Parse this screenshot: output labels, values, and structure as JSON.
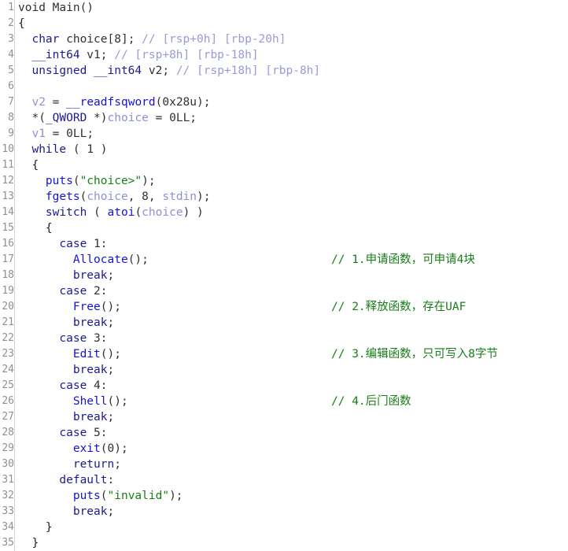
{
  "view": {
    "name": "pseudocode-decompiler-view",
    "background": "#ffffff",
    "gutter_color": "#909090",
    "colors": {
      "keyword": "#1b1b8f",
      "function": "#1414d2",
      "variable": "#8f8fd6",
      "string": "#177e17",
      "comment": "#177e17",
      "stack_comment": "#9a9ad8",
      "plain": "#202020"
    },
    "first_line": 1,
    "last_line": 35,
    "total_lines": 35
  },
  "lines": [
    {
      "num": "1",
      "indent": 0,
      "tokens": [
        {
          "t": "plain",
          "v": "void Main()"
        }
      ]
    },
    {
      "num": "2",
      "indent": 0,
      "tokens": [
        {
          "t": "punc",
          "v": "{"
        }
      ]
    },
    {
      "num": "3",
      "indent": 1,
      "tokens": [
        {
          "t": "kw",
          "v": "char"
        },
        {
          "t": "plain",
          "v": " choice[8]; "
        },
        {
          "t": "cmt-blue",
          "v": "// [rsp+0h] [rbp-20h]"
        }
      ]
    },
    {
      "num": "4",
      "indent": 1,
      "tokens": [
        {
          "t": "kw",
          "v": "__int64"
        },
        {
          "t": "plain",
          "v": " v1; "
        },
        {
          "t": "cmt-blue",
          "v": "// [rsp+8h] [rbp-18h]"
        }
      ]
    },
    {
      "num": "5",
      "indent": 1,
      "tokens": [
        {
          "t": "kw",
          "v": "unsigned __int64"
        },
        {
          "t": "plain",
          "v": " v2; "
        },
        {
          "t": "cmt-blue",
          "v": "// [rsp+18h] [rbp-8h]"
        }
      ]
    },
    {
      "num": "6",
      "indent": 0,
      "tokens": []
    },
    {
      "num": "7",
      "indent": 1,
      "tokens": [
        {
          "t": "var",
          "v": "v2"
        },
        {
          "t": "plain",
          "v": " = "
        },
        {
          "t": "fn",
          "v": "__readfsqword"
        },
        {
          "t": "plain",
          "v": "(0x28u);"
        }
      ]
    },
    {
      "num": "8",
      "indent": 1,
      "tokens": [
        {
          "t": "plain",
          "v": "*("
        },
        {
          "t": "kw",
          "v": "_QWORD"
        },
        {
          "t": "plain",
          "v": " *)"
        },
        {
          "t": "var",
          "v": "choice"
        },
        {
          "t": "plain",
          "v": " = 0LL;"
        }
      ]
    },
    {
      "num": "9",
      "indent": 1,
      "tokens": [
        {
          "t": "var",
          "v": "v1"
        },
        {
          "t": "plain",
          "v": " = 0LL;"
        }
      ]
    },
    {
      "num": "10",
      "indent": 1,
      "tokens": [
        {
          "t": "kw",
          "v": "while"
        },
        {
          "t": "plain",
          "v": " ( 1 )"
        }
      ]
    },
    {
      "num": "11",
      "indent": 1,
      "tokens": [
        {
          "t": "punc",
          "v": "{"
        }
      ]
    },
    {
      "num": "12",
      "indent": 2,
      "tokens": [
        {
          "t": "fn",
          "v": "puts"
        },
        {
          "t": "plain",
          "v": "("
        },
        {
          "t": "str",
          "v": "\"choice>\""
        },
        {
          "t": "plain",
          "v": ");"
        }
      ]
    },
    {
      "num": "13",
      "indent": 2,
      "tokens": [
        {
          "t": "fn",
          "v": "fgets"
        },
        {
          "t": "plain",
          "v": "("
        },
        {
          "t": "var",
          "v": "choice"
        },
        {
          "t": "plain",
          "v": ", 8, "
        },
        {
          "t": "var",
          "v": "stdin"
        },
        {
          "t": "plain",
          "v": ");"
        }
      ]
    },
    {
      "num": "14",
      "indent": 2,
      "tokens": [
        {
          "t": "kw",
          "v": "switch"
        },
        {
          "t": "plain",
          "v": " ( "
        },
        {
          "t": "fn",
          "v": "atoi"
        },
        {
          "t": "plain",
          "v": "("
        },
        {
          "t": "var",
          "v": "choice"
        },
        {
          "t": "plain",
          "v": ") )"
        }
      ]
    },
    {
      "num": "15",
      "indent": 2,
      "tokens": [
        {
          "t": "punc",
          "v": "{"
        }
      ]
    },
    {
      "num": "16",
      "indent": 3,
      "tokens": [
        {
          "t": "kw",
          "v": "case"
        },
        {
          "t": "plain",
          "v": " 1:"
        }
      ]
    },
    {
      "num": "17",
      "indent": 4,
      "tokens": [
        {
          "t": "fn",
          "v": "Allocate"
        },
        {
          "t": "plain",
          "v": "();"
        }
      ],
      "comment": "// 1.申请函数，可申请4块"
    },
    {
      "num": "18",
      "indent": 4,
      "tokens": [
        {
          "t": "kw",
          "v": "break"
        },
        {
          "t": "plain",
          "v": ";"
        }
      ]
    },
    {
      "num": "19",
      "indent": 3,
      "tokens": [
        {
          "t": "kw",
          "v": "case"
        },
        {
          "t": "plain",
          "v": " 2:"
        }
      ]
    },
    {
      "num": "20",
      "indent": 4,
      "tokens": [
        {
          "t": "fn",
          "v": "Free"
        },
        {
          "t": "plain",
          "v": "();"
        }
      ],
      "comment": "// 2.释放函数，存在UAF"
    },
    {
      "num": "21",
      "indent": 4,
      "tokens": [
        {
          "t": "kw",
          "v": "break"
        },
        {
          "t": "plain",
          "v": ";"
        }
      ]
    },
    {
      "num": "22",
      "indent": 3,
      "tokens": [
        {
          "t": "kw",
          "v": "case"
        },
        {
          "t": "plain",
          "v": " 3:"
        }
      ]
    },
    {
      "num": "23",
      "indent": 4,
      "tokens": [
        {
          "t": "fn",
          "v": "Edit"
        },
        {
          "t": "plain",
          "v": "();"
        }
      ],
      "comment": "// 3.编辑函数，只可写入8字节"
    },
    {
      "num": "24",
      "indent": 4,
      "tokens": [
        {
          "t": "kw",
          "v": "break"
        },
        {
          "t": "plain",
          "v": ";"
        }
      ]
    },
    {
      "num": "25",
      "indent": 3,
      "tokens": [
        {
          "t": "kw",
          "v": "case"
        },
        {
          "t": "plain",
          "v": " 4:"
        }
      ]
    },
    {
      "num": "26",
      "indent": 4,
      "tokens": [
        {
          "t": "fn",
          "v": "Shell"
        },
        {
          "t": "plain",
          "v": "();"
        }
      ],
      "comment": "// 4.后门函数"
    },
    {
      "num": "27",
      "indent": 4,
      "tokens": [
        {
          "t": "kw",
          "v": "break"
        },
        {
          "t": "plain",
          "v": ";"
        }
      ]
    },
    {
      "num": "28",
      "indent": 3,
      "tokens": [
        {
          "t": "kw",
          "v": "case"
        },
        {
          "t": "plain",
          "v": " 5:"
        }
      ]
    },
    {
      "num": "29",
      "indent": 4,
      "tokens": [
        {
          "t": "fn",
          "v": "exit"
        },
        {
          "t": "plain",
          "v": "(0);"
        }
      ]
    },
    {
      "num": "30",
      "indent": 4,
      "tokens": [
        {
          "t": "kw",
          "v": "return"
        },
        {
          "t": "plain",
          "v": ";"
        }
      ]
    },
    {
      "num": "31",
      "indent": 3,
      "tokens": [
        {
          "t": "kw",
          "v": "default"
        },
        {
          "t": "plain",
          "v": ":"
        }
      ]
    },
    {
      "num": "32",
      "indent": 4,
      "tokens": [
        {
          "t": "fn",
          "v": "puts"
        },
        {
          "t": "plain",
          "v": "("
        },
        {
          "t": "str",
          "v": "\"invalid\""
        },
        {
          "t": "plain",
          "v": ");"
        }
      ]
    },
    {
      "num": "33",
      "indent": 4,
      "tokens": [
        {
          "t": "kw",
          "v": "break"
        },
        {
          "t": "plain",
          "v": ";"
        }
      ]
    },
    {
      "num": "34",
      "indent": 2,
      "tokens": [
        {
          "t": "punc",
          "v": "}"
        }
      ]
    },
    {
      "num": "35",
      "indent": 1,
      "tokens": [
        {
          "t": "punc",
          "v": "}"
        }
      ]
    }
  ]
}
